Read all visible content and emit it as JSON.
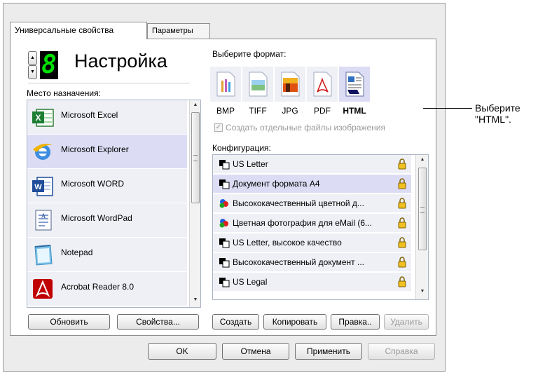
{
  "tabs": [
    {
      "label": "Универсальные свойства"
    },
    {
      "label": "Параметры"
    }
  ],
  "header": {
    "digit": "8",
    "title": "Настройка"
  },
  "destination": {
    "label": "Место назначения:",
    "items": [
      {
        "label": "Microsoft Excel",
        "icon": "excel-icon"
      },
      {
        "label": "Microsoft Explorer",
        "icon": "internet-explorer-icon"
      },
      {
        "label": "Microsoft WORD",
        "icon": "word-icon"
      },
      {
        "label": "Microsoft WordPad",
        "icon": "wordpad-icon"
      },
      {
        "label": "Notepad",
        "icon": "notepad-icon"
      },
      {
        "label": "Acrobat Reader 8.0",
        "icon": "acrobat-icon"
      }
    ],
    "refresh_label": "Обновить",
    "properties_label": "Свойства..."
  },
  "format": {
    "label": "Выберите формат:",
    "items": [
      {
        "label": "BMP",
        "icon": "bmp-file-icon"
      },
      {
        "label": "TIFF",
        "icon": "tiff-file-icon"
      },
      {
        "label": "JPG",
        "icon": "jpg-file-icon"
      },
      {
        "label": "PDF",
        "icon": "pdf-file-icon"
      },
      {
        "label": "HTML",
        "icon": "html-file-icon"
      }
    ],
    "separate_files_label": "Создать отдельные файлы изображения"
  },
  "configuration": {
    "label": "Конфигурация:",
    "items": [
      {
        "label": "US Letter"
      },
      {
        "label": "Документ формата А4"
      },
      {
        "label": "Высококачественный цветной д..."
      },
      {
        "label": "Цветная фотография для eMail (6..."
      },
      {
        "label": "US Letter, высокое качество"
      },
      {
        "label": "Высококачественный документ ..."
      },
      {
        "label": "US Legal"
      }
    ],
    "create_label": "Создать",
    "copy_label": "Копировать",
    "edit_label": "Правка..",
    "delete_label": "Удалить"
  },
  "footer": {
    "ok_label": "OK",
    "cancel_label": "Отмена",
    "apply_label": "Применить",
    "help_label": "Справка"
  },
  "callout": {
    "line1": "Выберите",
    "line2": "\"HTML\"."
  },
  "colors": {
    "selection": "#dcdcf4",
    "digit_green": "#00e000"
  }
}
